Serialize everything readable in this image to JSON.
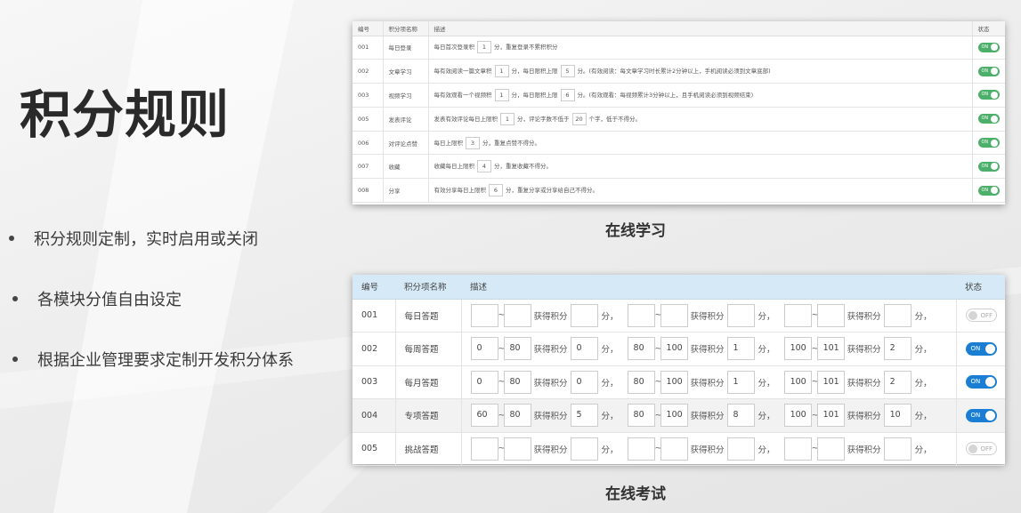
{
  "title": "积分规则",
  "bullets": [
    "积分规则定制，实时启用或关闭",
    "各模块分值自由设定",
    "根据企业管理要求定制开发积分体系"
  ],
  "learning": {
    "caption": "在线学习",
    "headers": [
      "编号",
      "积分项名称",
      "描述",
      "状态"
    ],
    "rows": [
      {
        "id": "001",
        "name": "每日登录",
        "p1": "每日首次登录积",
        "v1": "1",
        "p2": "分，重复登录不累积积分",
        "v2": "",
        "p3": "",
        "status": "ON"
      },
      {
        "id": "002",
        "name": "文章学习",
        "p1": "每有效阅读一篇文章积",
        "v1": "1",
        "p2": "分，每日限积上限",
        "v2": "5",
        "p3": "分。(有效阅读：每文章学习时长累计2分钟以上，手机阅读必须到文章底部)",
        "status": "ON"
      },
      {
        "id": "003",
        "name": "视频学习",
        "p1": "每有效观看一个视频积",
        "v1": "1",
        "p2": "分，每日限积上限",
        "v2": "6",
        "p3": "分。(有效观看：每视频累计3分钟以上，且手机阅读必须到视频结束)",
        "status": "ON"
      },
      {
        "id": "005",
        "name": "发表评论",
        "p1": "发表有效评论每日上限积",
        "v1": "1",
        "p2": "分，评论字数不低于",
        "v2": "20",
        "p3": "个字，低于不得分。",
        "status": "ON"
      },
      {
        "id": "006",
        "name": "对评论点赞",
        "p1": "每日上限积",
        "v1": "3",
        "p2": "分，重复点赞不得分。",
        "v2": "",
        "p3": "",
        "status": "ON"
      },
      {
        "id": "007",
        "name": "收藏",
        "p1": "收藏每日上限积",
        "v1": "4",
        "p2": "分，重复收藏不得分。",
        "v2": "",
        "p3": "",
        "status": "ON"
      },
      {
        "id": "008",
        "name": "分享",
        "p1": "有效分享每日上限积",
        "v1": "6",
        "p2": "分，重复分享或分享给自己不得分。",
        "v2": "",
        "p3": "",
        "status": "ON"
      }
    ]
  },
  "exam": {
    "caption": "在线考试",
    "headers": [
      "编号",
      "积分项名称",
      "描述",
      "状态"
    ],
    "sep": "~",
    "label": "获得积分",
    "unit": "分，",
    "rows": [
      {
        "id": "001",
        "name": "每日答题",
        "ranges": [
          [
            "",
            "",
            ""
          ],
          [
            "",
            "",
            ""
          ],
          [
            "",
            "",
            ""
          ]
        ],
        "status": "OFF"
      },
      {
        "id": "002",
        "name": "每周答题",
        "ranges": [
          [
            "0",
            "80",
            "0"
          ],
          [
            "80",
            "100",
            "1"
          ],
          [
            "100",
            "101",
            "2"
          ]
        ],
        "status": "ON"
      },
      {
        "id": "003",
        "name": "每月答题",
        "ranges": [
          [
            "0",
            "80",
            "0"
          ],
          [
            "80",
            "100",
            "1"
          ],
          [
            "100",
            "101",
            "2"
          ]
        ],
        "status": "ON"
      },
      {
        "id": "004",
        "name": "专项答题",
        "ranges": [
          [
            "60",
            "80",
            "5"
          ],
          [
            "80",
            "100",
            "8"
          ],
          [
            "100",
            "101",
            "10"
          ]
        ],
        "status": "ON"
      },
      {
        "id": "005",
        "name": "挑战答题",
        "ranges": [
          [
            "",
            "",
            ""
          ],
          [
            "",
            "",
            ""
          ],
          [
            "",
            "",
            ""
          ]
        ],
        "status": "OFF"
      }
    ]
  }
}
